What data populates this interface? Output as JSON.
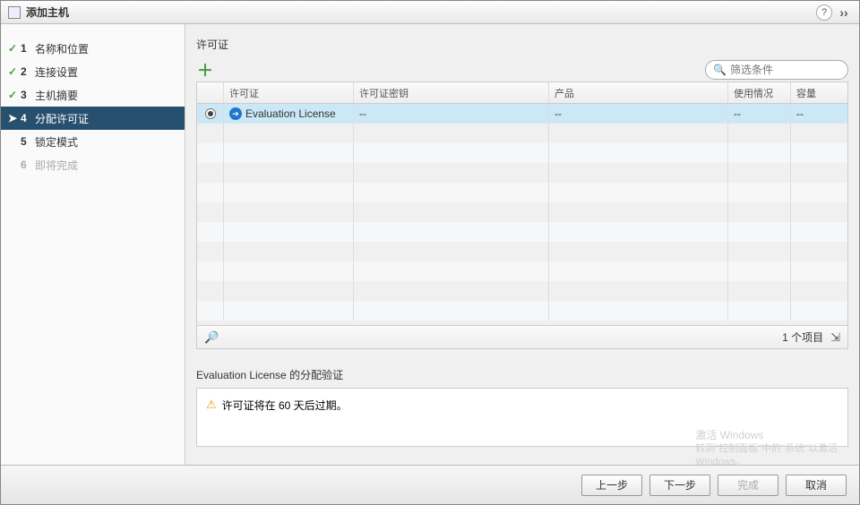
{
  "title": "添加主机",
  "steps": [
    {
      "num": "1",
      "label": "名称和位置",
      "done": true
    },
    {
      "num": "2",
      "label": "连接设置",
      "done": true
    },
    {
      "num": "3",
      "label": "主机摘要",
      "done": true
    },
    {
      "num": "4",
      "label": "分配许可证",
      "current": true
    },
    {
      "num": "5",
      "label": "锁定模式"
    },
    {
      "num": "6",
      "label": "即将完成",
      "disabled": true
    }
  ],
  "section_title": "许可证",
  "filter_placeholder": "筛选条件",
  "columns": {
    "license": "许可证",
    "key": "许可证密钥",
    "product": "产品",
    "usage": "使用情况",
    "capacity": "容量"
  },
  "rows": [
    {
      "license": "Evaluation License",
      "key": "--",
      "product": "--",
      "usage": "--",
      "capacity": "--",
      "selected": true
    }
  ],
  "item_count": "1 个项目",
  "validation_title": "Evaluation License 的分配验证",
  "validation_msg": "许可证将在 60 天后过期。",
  "buttons": {
    "back": "上一步",
    "next": "下一步",
    "finish": "完成",
    "cancel": "取消"
  },
  "watermark": {
    "line1": "激活 Windows",
    "line2": "转到\"控制面板\"中的\"系统\"以激活",
    "line3": "Windows。"
  }
}
